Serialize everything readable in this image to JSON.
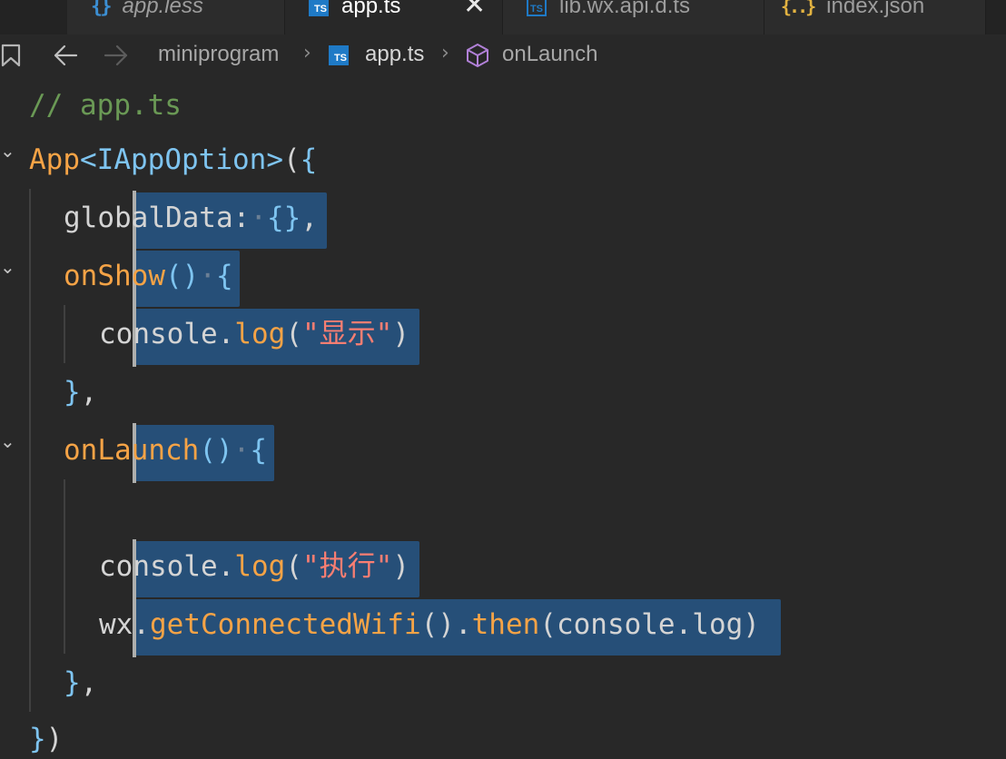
{
  "tabs": [
    {
      "name": "app.less",
      "icon": "less-file-icon",
      "italic": true,
      "active": false
    },
    {
      "name": "app.ts",
      "icon": "ts-file-icon",
      "italic": false,
      "active": true
    },
    {
      "name": "lib.wx.api.d.ts",
      "icon": "ts-declaration-file-icon",
      "italic": false,
      "active": false
    },
    {
      "name": "index.json",
      "icon": "json-file-icon",
      "italic": false,
      "active": false
    }
  ],
  "tab_icon_glyphs": {
    "less": "{}",
    "ts": "TS",
    "json": "{..}"
  },
  "close_glyph": "✕",
  "breadcrumb": {
    "folder": "miniprogram",
    "file": "app.ts",
    "symbol": "onLaunch",
    "separator": "›"
  },
  "code": {
    "comment": "// app.ts",
    "line2": {
      "app": "App",
      "lt": "<",
      "type": "IAppOption",
      "gt": ">",
      "open": "(",
      "brace": "{"
    },
    "line3": {
      "key": "globalData",
      "colon": ":",
      "value": "{}",
      "comma": ","
    },
    "line4": {
      "name": "onShow",
      "parens": "()",
      "brace": "{"
    },
    "line5": {
      "obj": "console",
      "dot": ".",
      "method": "log",
      "open": "(",
      "q1": "\"",
      "str": "显示",
      "q2": "\"",
      "close": ")"
    },
    "line6": {
      "brace": "}",
      "comma": ","
    },
    "line7": {
      "name": "onLaunch",
      "parens": "()",
      "brace": "{"
    },
    "line9": {
      "obj": "console",
      "dot": ".",
      "method": "log",
      "open": "(",
      "q1": "\"",
      "str": "执行",
      "q2": "\"",
      "close": ")"
    },
    "line10": {
      "obj": "wx",
      "dot": ".",
      "method": "getConnectedWifi",
      "parens": "()",
      "dot2": ".",
      "then": "then",
      "open": "(",
      "arg_obj": "console",
      "arg_dot": ".",
      "arg_method": "log",
      "close": ")"
    },
    "line11": {
      "brace": "}",
      "comma": ","
    },
    "line12": {
      "brace": "}",
      "paren": ")"
    }
  },
  "whitespace_dot": "·",
  "fold_glyph": "⌄",
  "colors": {
    "background": "#282828",
    "selection": "#264f78",
    "function": "#f5a346",
    "type": "#7ec4f0",
    "string": "#f97e72",
    "comment": "#6a9955"
  }
}
